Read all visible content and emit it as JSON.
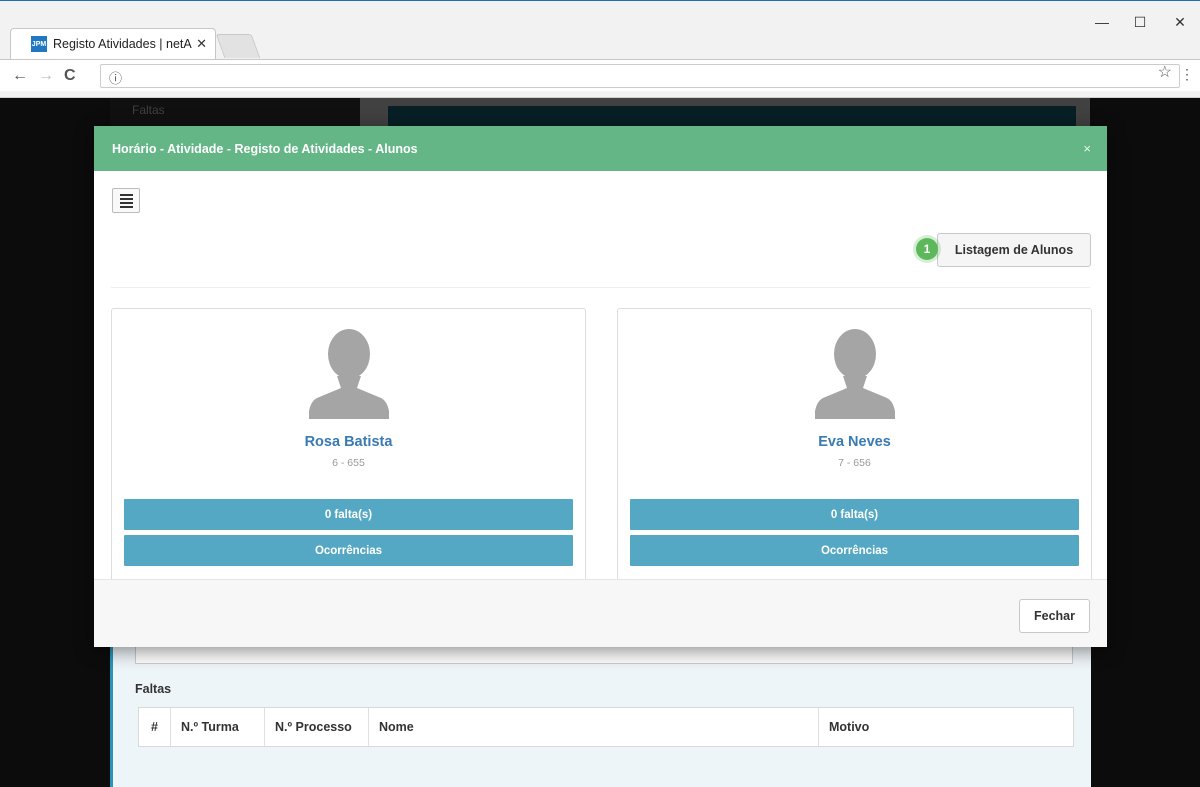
{
  "browser": {
    "tab_title": "Registo Atividades | netA",
    "favicon_text": "JPM",
    "close_tab_symbol": "✕",
    "info_symbol": "ⓘ",
    "star_symbol": "☆",
    "menu_symbol": "⋮",
    "back_symbol": "←",
    "forward_symbol": "→",
    "reload_symbol": "C",
    "minimize_symbol": "—",
    "maximize_symbol": "☐",
    "close_window_symbol": "✕"
  },
  "background_page": {
    "sidebar_item": "Faltas",
    "section_title": "Faltas",
    "table_headers": [
      "#",
      "N.º Turma",
      "N.º Processo",
      "Nome",
      "Motivo"
    ]
  },
  "modal": {
    "title": "Horário - Atividade - Registo de Atividades - Alunos",
    "close_symbol": "×",
    "badge_number": "1",
    "listagem_button": "Listagem de Alunos",
    "students": [
      {
        "name": "Rosa Batista",
        "code": "6 - 655",
        "faltas_button": "0 falta(s)",
        "ocorrencias_button": "Ocorrências"
      },
      {
        "name": "Eva Neves",
        "code": "7 - 656",
        "faltas_button": "0 falta(s)",
        "ocorrencias_button": "Ocorrências"
      }
    ],
    "fechar_button": "Fechar"
  },
  "colors": {
    "modal_header": "#64b687",
    "card_button": "#55a8c3",
    "student_name": "#3a7ab2",
    "badge": "#5db85c"
  }
}
